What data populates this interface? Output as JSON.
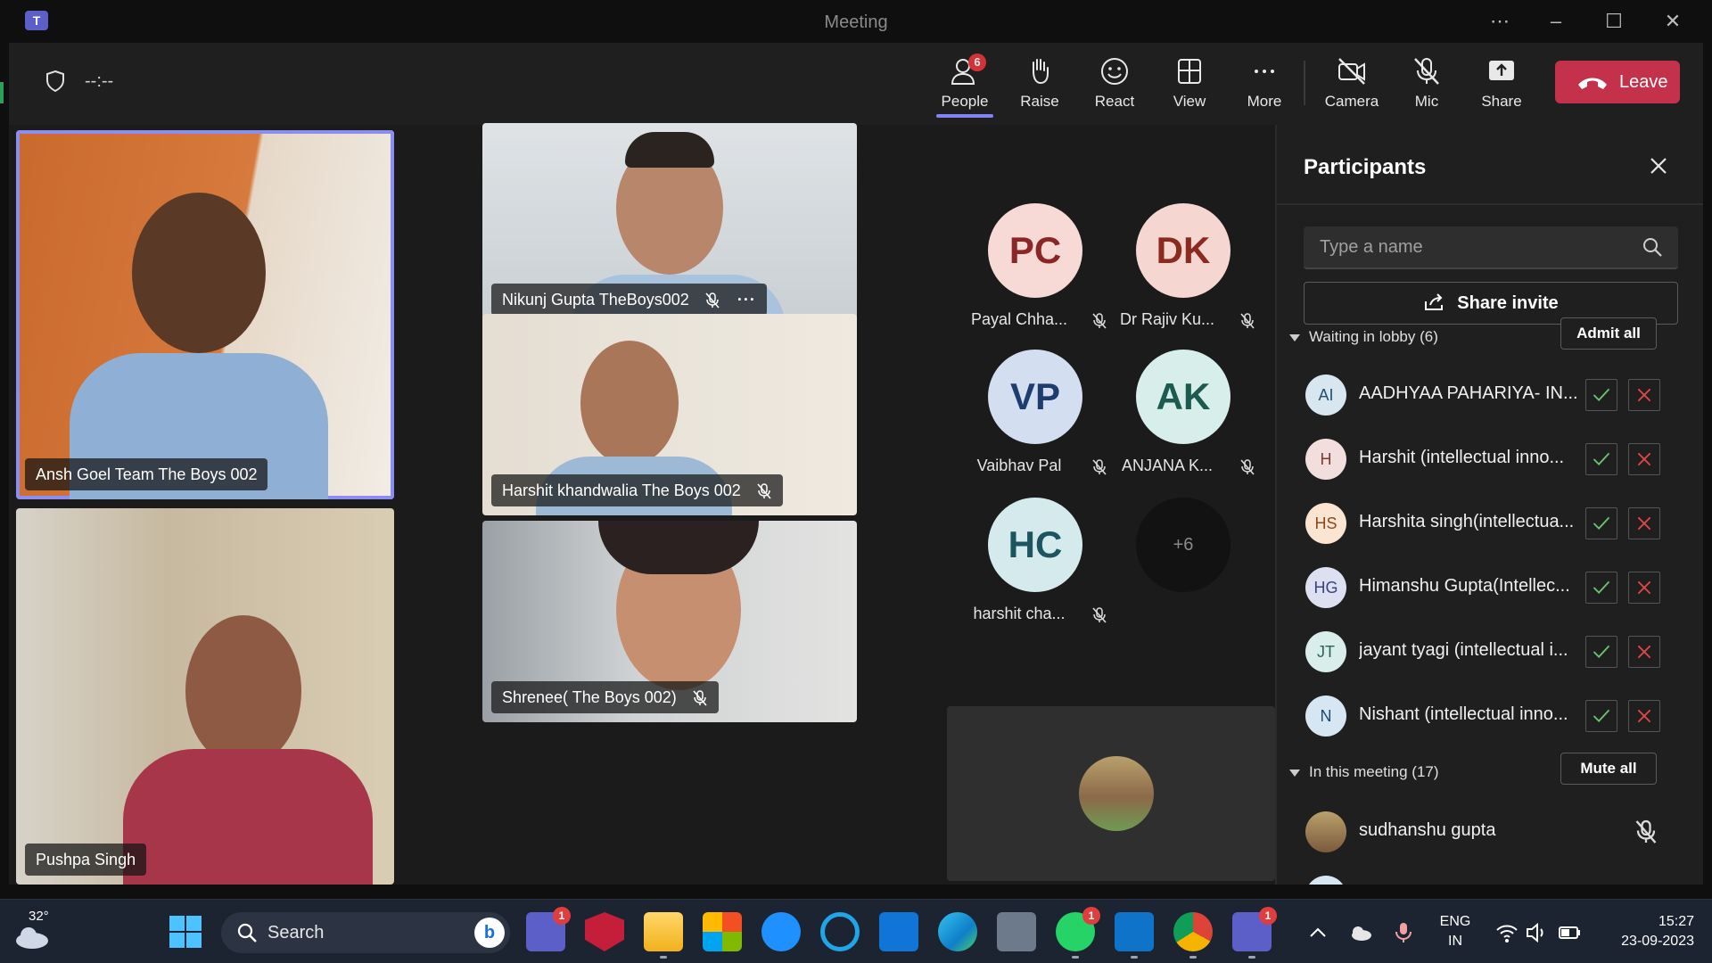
{
  "window": {
    "title": "Meeting"
  },
  "toolbar": {
    "timer": "--:--",
    "people": {
      "label": "People",
      "badge": "6"
    },
    "raise": "Raise",
    "react": "React",
    "view": "View",
    "more": "More",
    "camera": "Camera",
    "mic": "Mic",
    "share": "Share",
    "leave": "Leave"
  },
  "stage": {
    "videos": [
      {
        "name": "Ansh Goel Team The Boys 002"
      },
      {
        "name": "Nikunj Gupta TheBoys002"
      },
      {
        "name": "Harshit khandwalia The Boys 002"
      },
      {
        "name": "Pushpa Singh"
      },
      {
        "name": "Shrenee( The Boys 002)"
      }
    ],
    "avatars": [
      {
        "initials": "PC",
        "name": "Payal Chha...",
        "bg": "#f7d9d6",
        "fg": "#8b2626"
      },
      {
        "initials": "DK",
        "name": "Dr Rajiv Ku...",
        "bg": "#f5d6d0",
        "fg": "#8b2b20"
      },
      {
        "initials": "VP",
        "name": "Vaibhav Pal",
        "bg": "#d3def0",
        "fg": "#1e3c6e"
      },
      {
        "initials": "AK",
        "name": "ANJANA K...",
        "bg": "#d7eeea",
        "fg": "#1d5a50"
      },
      {
        "initials": "HC",
        "name": "harshit cha...",
        "bg": "#d5eaec",
        "fg": "#1c5560"
      }
    ],
    "overflow": "+6"
  },
  "panel": {
    "title": "Participants",
    "search_placeholder": "Type a name",
    "share_invite": "Share invite",
    "lobby": {
      "label": "Waiting in lobby (6)",
      "button": "Admit all",
      "people": [
        {
          "initials": "AI",
          "name": "AADHYAA PAHARIYA- IN...",
          "bg": "#d8e6ef",
          "fg": "#245070"
        },
        {
          "initials": "H",
          "name": "Harshit (intellectual inno...",
          "bg": "#f2dedd",
          "fg": "#7a3a35"
        },
        {
          "initials": "HS",
          "name": "Harshita singh(intellectua...",
          "bg": "#fbe4d2",
          "fg": "#8a4a1a"
        },
        {
          "initials": "HG",
          "name": "Himanshu Gupta(Intellec...",
          "bg": "#dde0f1",
          "fg": "#3a4380"
        },
        {
          "initials": "JT",
          "name": "jayant tyagi (intellectual i...",
          "bg": "#d9edea",
          "fg": "#2b6358"
        },
        {
          "initials": "N",
          "name": "Nishant (intellectual inno...",
          "bg": "#d6e6f3",
          "fg": "#1d4a72"
        }
      ]
    },
    "meeting": {
      "label": "In this meeting (17)",
      "button": "Mute all",
      "people": [
        {
          "name": "sudhanshu gupta"
        }
      ]
    }
  },
  "taskbar": {
    "temperature": "32°",
    "search_label": "Search",
    "teams_badge": "1",
    "whatsapp_badge": "1",
    "teams2_badge": "1",
    "lang_line1": "ENG",
    "lang_line2": "IN",
    "time": "15:27",
    "date": "23-09-2023"
  },
  "colors": {
    "accent": "#7f85f5",
    "leave": "#c4314b",
    "people_badge": "#d13438",
    "approve": "#6cc070",
    "deny": "#e04848"
  }
}
